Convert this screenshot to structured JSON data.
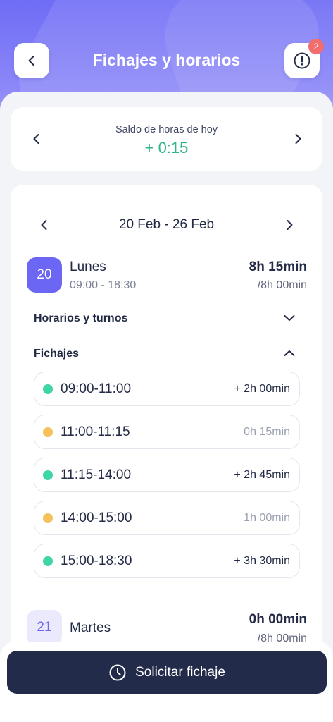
{
  "header": {
    "title": "Fichajes y horarios",
    "notification_count": "2"
  },
  "balance": {
    "label": "Saldo de horas de hoy",
    "value": "+ 0:15"
  },
  "week": {
    "range": "20 Feb - 26 Feb"
  },
  "days": [
    {
      "number": "20",
      "name": "Lunes",
      "hours": "09:00 - 18:30",
      "total": "8h 15min",
      "expected": "/8h 00min"
    },
    {
      "number": "21",
      "name": "Martes",
      "hours": "",
      "total": "0h 00min",
      "expected": "/8h 00min"
    }
  ],
  "sections": {
    "schedules": "Horarios y turnos",
    "punches": "Fichajes"
  },
  "entries": [
    {
      "range": "09:00-11:00",
      "duration": "+ 2h 00min",
      "type": "work"
    },
    {
      "range": "11:00-11:15",
      "duration": "0h 15min",
      "type": "break"
    },
    {
      "range": "11:15-14:00",
      "duration": "+ 2h 45min",
      "type": "work"
    },
    {
      "range": "14:00-15:00",
      "duration": "1h 00min",
      "type": "break"
    },
    {
      "range": "15:00-18:30",
      "duration": "+ 3h 30min",
      "type": "work"
    }
  ],
  "cta": {
    "label": "Solicitar fichaje"
  },
  "colors": {
    "accent": "#6b66f4",
    "positive": "#2fb58a",
    "work_dot": "#3fd6a6",
    "break_dot": "#f4c15a",
    "cta_bg": "#232b4a"
  },
  "icons": {
    "back": "chevron-left-icon",
    "alert": "alert-circle-icon",
    "prev": "chevron-left-icon",
    "next": "chevron-right-icon",
    "expand": "chevron-down-icon",
    "collapse": "chevron-up-icon",
    "clock": "clock-icon"
  }
}
